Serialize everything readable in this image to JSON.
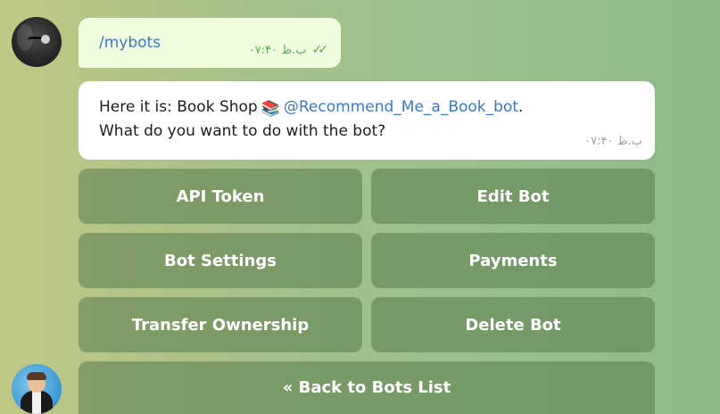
{
  "colors": {
    "outgoing_bubble": "#effdde",
    "incoming_bubble": "#ffffff",
    "link": "#3a79c4",
    "button_bg": "#6a8e5c"
  },
  "messages": {
    "outgoing": {
      "text": "/mybots",
      "time": "۰۷:۴۰ ب.ظ",
      "status_icon": "double-check-icon"
    },
    "incoming": {
      "text_prefix": "Here it is: Book Shop",
      "emoji": "📚",
      "mention": "@Recommend_Me_a_Book_bot",
      "text_suffix": ".",
      "line2": "What do you want to do with the bot?",
      "time": "۰۷:۴۰ ب.ظ"
    }
  },
  "keyboard": {
    "rows": [
      [
        "API Token",
        "Edit Bot"
      ],
      [
        "Bot Settings",
        "Payments"
      ],
      [
        "Transfer Ownership",
        "Delete Bot"
      ],
      [
        "« Back to Bots List"
      ]
    ]
  }
}
